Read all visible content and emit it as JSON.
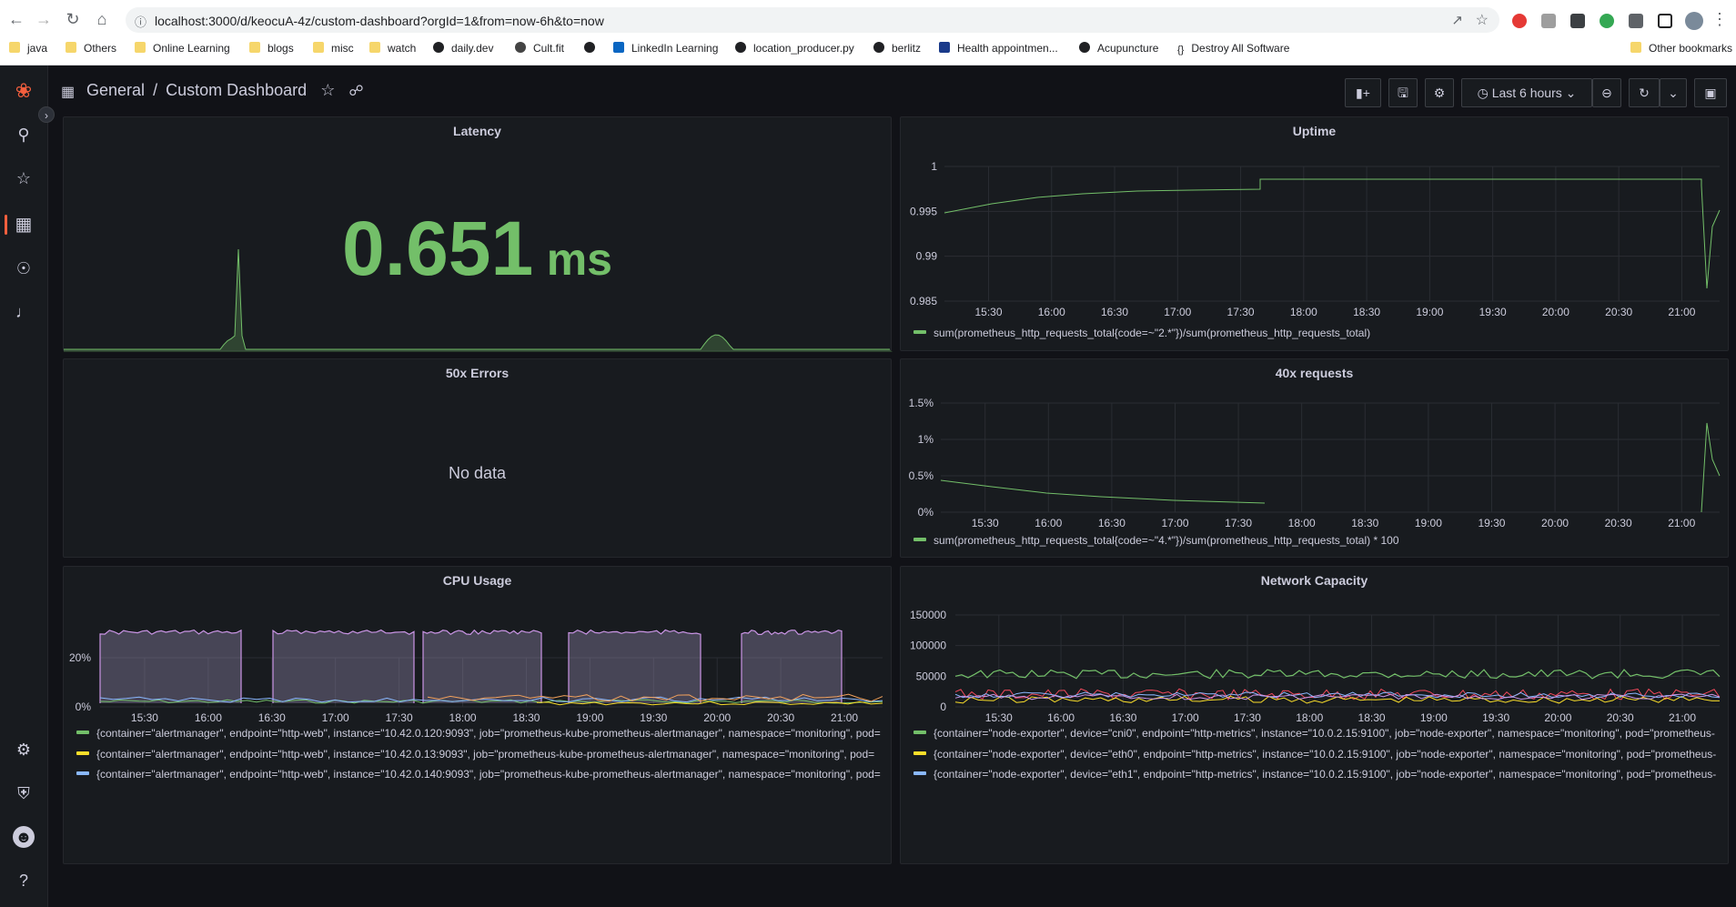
{
  "browser": {
    "url": "localhost:3000/d/keocuA-4z/custom-dashboard?orgId=1&from=now-6h&to=now",
    "bookmarks": [
      "java",
      "Others",
      "Online Learning",
      "blogs",
      "misc",
      "watch",
      "daily.dev",
      "Cult.fit",
      "",
      "LinkedIn Learning",
      "location_producer.py",
      "berlitz",
      "Health appointmen...",
      "Acupuncture",
      "Destroy All Software"
    ],
    "other_bookmarks": "Other bookmarks"
  },
  "topbar": {
    "folder": "General",
    "separator": "/",
    "dashboard": "Custom Dashboard",
    "time_range": "Last 6 hours"
  },
  "time_ticks": [
    "15:30",
    "16:00",
    "16:30",
    "17:00",
    "17:30",
    "18:00",
    "18:30",
    "19:00",
    "19:30",
    "20:00",
    "20:30",
    "21:00"
  ],
  "panels": {
    "latency": {
      "title": "Latency",
      "value": "0.651",
      "unit": "ms"
    },
    "uptime": {
      "title": "Uptime",
      "y_ticks": [
        "1",
        "0.995",
        "0.99",
        "0.985"
      ],
      "legend": "sum(prometheus_http_requests_total{code=~\"2.*\"})/sum(prometheus_http_requests_total)"
    },
    "errors50x": {
      "title": "50x Errors",
      "empty": "No data"
    },
    "requests40x": {
      "title": "40x requests",
      "y_ticks": [
        "1.5%",
        "1%",
        "0.5%",
        "0%"
      ],
      "legend": "sum(prometheus_http_requests_total{code=~\"4.*\"})/sum(prometheus_http_requests_total) * 100"
    },
    "cpu": {
      "title": "CPU Usage",
      "y_ticks": [
        "20%",
        "0%"
      ],
      "legends": [
        "{container=\"alertmanager\", endpoint=\"http-web\", instance=\"10.42.0.120:9093\", job=\"prometheus-kube-prometheus-alertmanager\", namespace=\"monitoring\", pod=",
        "{container=\"alertmanager\", endpoint=\"http-web\", instance=\"10.42.0.13:9093\", job=\"prometheus-kube-prometheus-alertmanager\", namespace=\"monitoring\", pod=",
        "{container=\"alertmanager\", endpoint=\"http-web\", instance=\"10.42.0.140:9093\", job=\"prometheus-kube-prometheus-alertmanager\", namespace=\"monitoring\", pod="
      ]
    },
    "network": {
      "title": "Network Capacity",
      "y_ticks": [
        "150000",
        "100000",
        "50000",
        "0"
      ],
      "legends": [
        "{container=\"node-exporter\", device=\"cni0\", endpoint=\"http-metrics\", instance=\"10.0.2.15:9100\", job=\"node-exporter\", namespace=\"monitoring\", pod=\"prometheus-",
        "{container=\"node-exporter\", device=\"eth0\", endpoint=\"http-metrics\", instance=\"10.0.2.15:9100\", job=\"node-exporter\", namespace=\"monitoring\", pod=\"prometheus-",
        "{container=\"node-exporter\", device=\"eth1\", endpoint=\"http-metrics\", instance=\"10.0.2.15:9100\", job=\"node-exporter\", namespace=\"monitoring\", pod=\"prometheus-"
      ]
    }
  },
  "colors": {
    "green": "#73bf69",
    "yellow": "#fade2a",
    "blue": "#8ab8ff",
    "purple": "#ca95e5",
    "red": "#f2495c",
    "accent": "#f55f3e"
  }
}
